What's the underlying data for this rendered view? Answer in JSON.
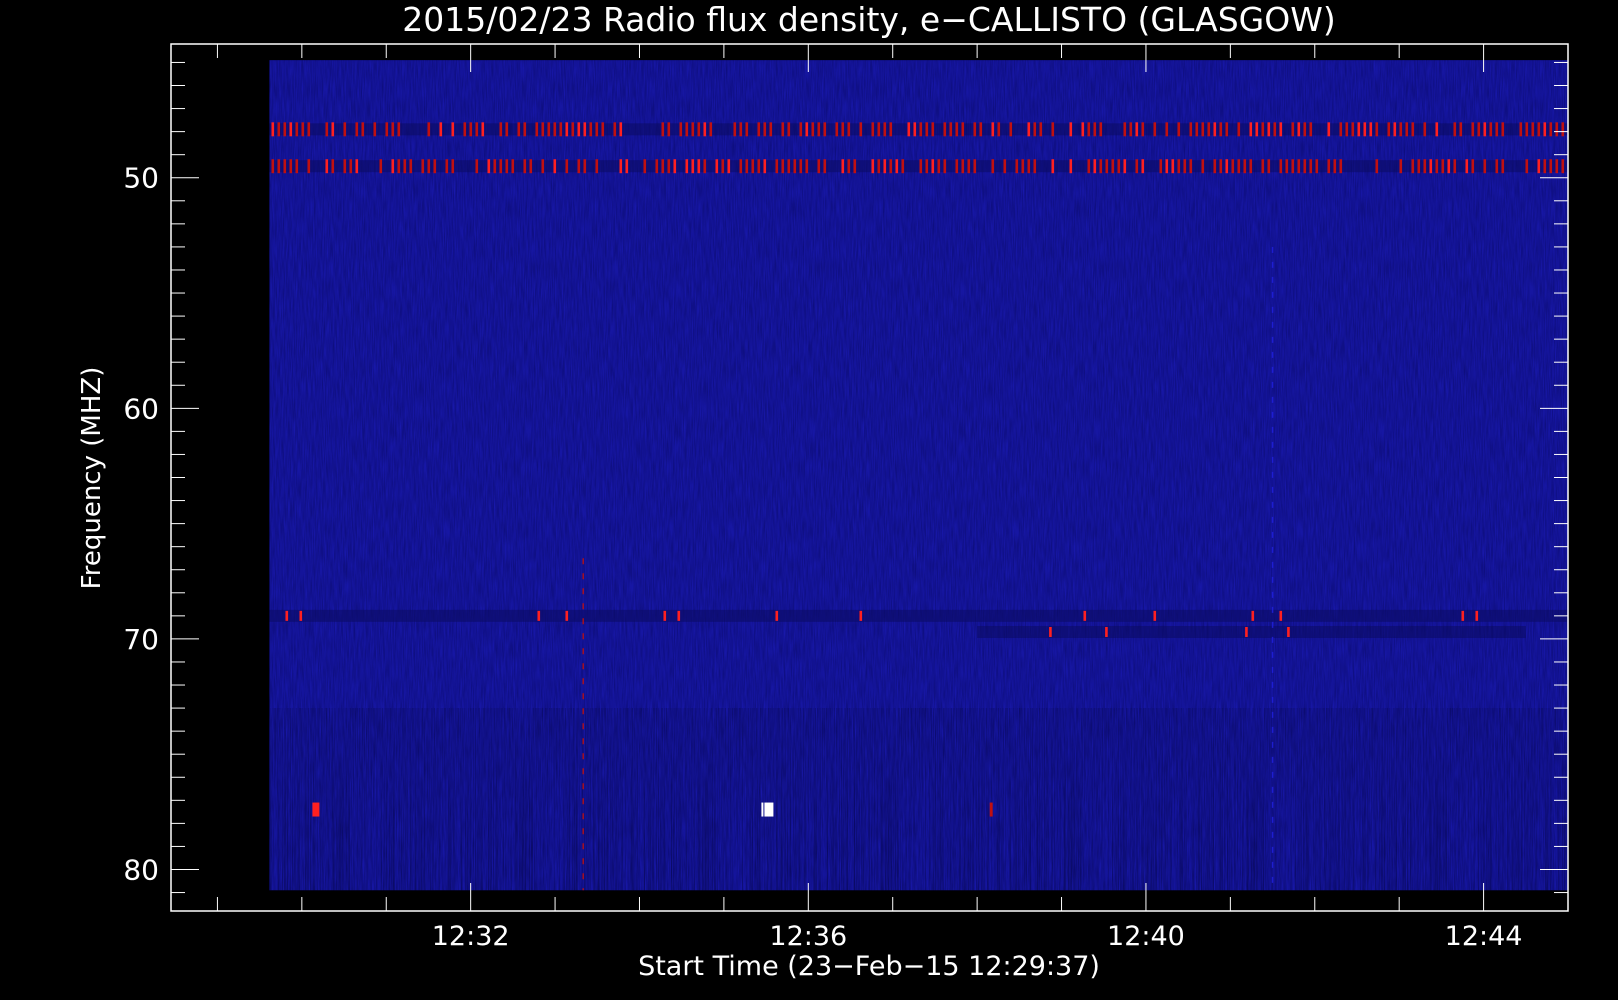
{
  "chart_data": {
    "type": "heatmap",
    "title": "2015/02/23  Radio flux density, e−CALLISTO (GLASGOW)",
    "xlabel": "Start Time (23−Feb−15 12:29:37)",
    "ylabel": "Frequency (MHZ)",
    "x_unit": "time (UT)",
    "y_unit": "MHz",
    "xlim": [
      "12:28:27",
      "12:45:00"
    ],
    "ylim": [
      81.8,
      44.2
    ],
    "data_xlim": [
      "12:29:37",
      "12:45:00"
    ],
    "data_ylim": [
      44.9,
      80.9
    ],
    "y_axis_inverted": true,
    "x_ticks": [
      "12:32",
      "12:36",
      "12:40",
      "12:44"
    ],
    "y_ticks": [
      50,
      60,
      70,
      80
    ],
    "colormap": [
      "#0b0b60",
      "#1a1ab4",
      "#2020dc",
      "#c01010",
      "#ff2020",
      "#ffffff"
    ],
    "background_level": "low (blue)",
    "features": [
      {
        "type": "interference_band",
        "freq_mhz": 47.9,
        "time_range": [
          "12:29:37",
          "12:45:00"
        ],
        "intensity": "high",
        "pattern": "intermittent"
      },
      {
        "type": "interference_band",
        "freq_mhz": 49.5,
        "time_range": [
          "12:29:37",
          "12:45:00"
        ],
        "intensity": "high",
        "pattern": "intermittent"
      },
      {
        "type": "interference_band",
        "freq_mhz": 69.0,
        "time_range": [
          "12:29:37",
          "12:45:00"
        ],
        "intensity": "medium",
        "pattern": "sparse"
      },
      {
        "type": "interference_band",
        "freq_mhz": 69.7,
        "time_range": [
          "12:38:00",
          "12:44:30"
        ],
        "intensity": "medium",
        "pattern": "sparse"
      },
      {
        "type": "spike",
        "time": "12:30:10",
        "freq_mhz": 77.4,
        "intensity": "high"
      },
      {
        "type": "spike",
        "time": "12:35:32",
        "freq_mhz": 77.4,
        "intensity": "very high"
      },
      {
        "type": "spike",
        "time": "12:38:10",
        "freq_mhz": 77.4,
        "intensity": "medium"
      },
      {
        "type": "vertical_streak",
        "time": "12:33:20",
        "freq_range_mhz": [
          66.5,
          80.9
        ],
        "intensity": "medium"
      },
      {
        "type": "vertical_streak",
        "time": "12:41:30",
        "freq_range_mhz": [
          53.0,
          80.9
        ],
        "intensity": "low"
      }
    ]
  }
}
